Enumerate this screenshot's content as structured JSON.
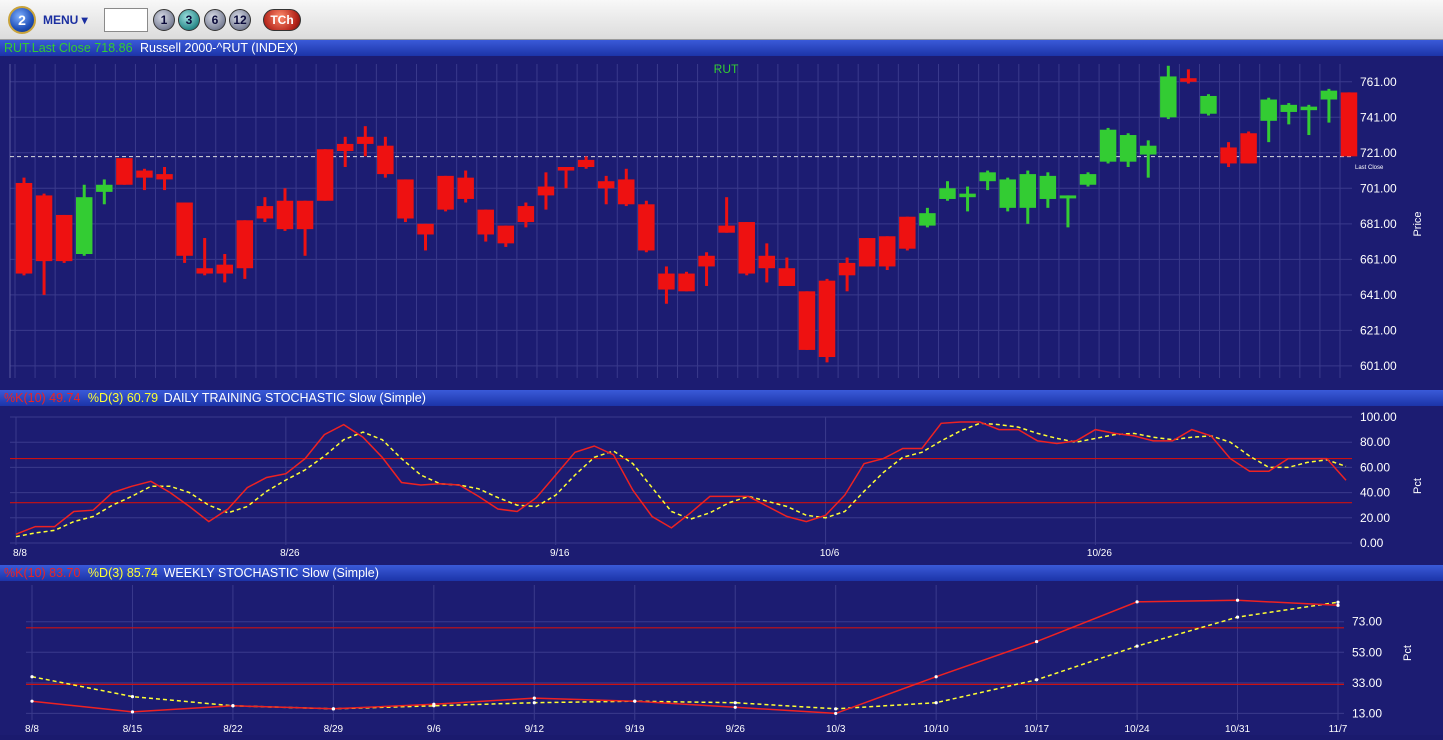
{
  "toolbar": {
    "logo_text": "2",
    "menu_label": "MENU ▾",
    "symbol_value": "",
    "period_buttons": [
      "1",
      "3",
      "6",
      "12"
    ],
    "active_period": "3",
    "tch_label": "TCh"
  },
  "header": {
    "last_close_label": "RUT.Last Close 718.86",
    "instrument": "Russell 2000-^RUT (INDEX)"
  },
  "colors": {
    "background": "#1c1c72",
    "grid": "#3a3a8c",
    "up_candle": "#33cc33",
    "down_candle": "#ee1111",
    "k_line": "#ee2222",
    "d_line": "#ffff33",
    "band_line": "#cc1111",
    "green_text": "#33cc33"
  },
  "price_chart": {
    "title": "RUT",
    "ylabel": "Price",
    "last_close_marker": "Last Close",
    "last_close": 718.86
  },
  "daily_stoch": {
    "k_label": "%K(10) 49.74",
    "d_label": "%D(3) 60.79",
    "title": "DAILY TRAINING STOCHASTIC Slow (Simple)",
    "ylabel": "Pct"
  },
  "weekly_stoch": {
    "k_label": "%K(10) 83.70",
    "d_label": "%D(3) 85.74",
    "title": "WEEKLY STOCHASTIC Slow (Simple)",
    "ylabel": "Pct"
  },
  "chart_data": [
    {
      "type": "candlestick",
      "title": "RUT",
      "ylabel": "Price",
      "ylim": [
        597,
        771
      ],
      "ytick_labels": [
        "601.00",
        "621.00",
        "641.00",
        "661.00",
        "681.00",
        "701.00",
        "721.00",
        "741.00",
        "761.00"
      ],
      "reference_line": 718.86,
      "candles": [
        {
          "o": 704,
          "c": 653,
          "h": 707,
          "l": 652
        },
        {
          "o": 697,
          "c": 660,
          "h": 698,
          "l": 641
        },
        {
          "o": 686,
          "c": 660,
          "h": 686,
          "l": 659
        },
        {
          "o": 664,
          "c": 696,
          "h": 703,
          "l": 663
        },
        {
          "o": 699,
          "c": 703,
          "h": 706,
          "l": 692
        },
        {
          "o": 718,
          "c": 703,
          "h": 718,
          "l": 703
        },
        {
          "o": 711,
          "c": 707,
          "h": 712,
          "l": 700
        },
        {
          "o": 709,
          "c": 706,
          "h": 713,
          "l": 700
        },
        {
          "o": 693,
          "c": 663,
          "h": 693,
          "l": 659
        },
        {
          "o": 656,
          "c": 653,
          "h": 673,
          "l": 652
        },
        {
          "o": 658,
          "c": 653,
          "h": 664,
          "l": 648
        },
        {
          "o": 683,
          "c": 656,
          "h": 683,
          "l": 650
        },
        {
          "o": 691,
          "c": 684,
          "h": 696,
          "l": 682
        },
        {
          "o": 694,
          "c": 678,
          "h": 701,
          "l": 677
        },
        {
          "o": 694,
          "c": 678,
          "h": 694,
          "l": 663
        },
        {
          "o": 723,
          "c": 694,
          "h": 723,
          "l": 694
        },
        {
          "o": 726,
          "c": 722,
          "h": 730,
          "l": 713
        },
        {
          "o": 730,
          "c": 726,
          "h": 736,
          "l": 719
        },
        {
          "o": 725,
          "c": 709,
          "h": 730,
          "l": 707
        },
        {
          "o": 706,
          "c": 684,
          "h": 706,
          "l": 682
        },
        {
          "o": 681,
          "c": 675,
          "h": 681,
          "l": 666
        },
        {
          "o": 708,
          "c": 689,
          "h": 708,
          "l": 688
        },
        {
          "o": 707,
          "c": 695,
          "h": 711,
          "l": 693
        },
        {
          "o": 689,
          "c": 675,
          "h": 689,
          "l": 671
        },
        {
          "o": 680,
          "c": 670,
          "h": 680,
          "l": 668
        },
        {
          "o": 691,
          "c": 682,
          "h": 693,
          "l": 679
        },
        {
          "o": 702,
          "c": 697,
          "h": 710,
          "l": 689
        },
        {
          "o": 713,
          "c": 711,
          "h": 713,
          "l": 701
        },
        {
          "o": 717,
          "c": 713,
          "h": 719,
          "l": 712
        },
        {
          "o": 705,
          "c": 701,
          "h": 708,
          "l": 692
        },
        {
          "o": 706,
          "c": 692,
          "h": 712,
          "l": 691
        },
        {
          "o": 692,
          "c": 666,
          "h": 694,
          "l": 665
        },
        {
          "o": 653,
          "c": 644,
          "h": 657,
          "l": 636
        },
        {
          "o": 653,
          "c": 643,
          "h": 654,
          "l": 643
        },
        {
          "o": 663,
          "c": 657,
          "h": 665,
          "l": 646
        },
        {
          "o": 680,
          "c": 676,
          "h": 696,
          "l": 676
        },
        {
          "o": 682,
          "c": 653,
          "h": 682,
          "l": 652
        },
        {
          "o": 663,
          "c": 656,
          "h": 670,
          "l": 648
        },
        {
          "o": 656,
          "c": 646,
          "h": 662,
          "l": 646
        },
        {
          "o": 643,
          "c": 610,
          "h": 643,
          "l": 610
        },
        {
          "o": 649,
          "c": 606,
          "h": 650,
          "l": 603
        },
        {
          "o": 659,
          "c": 652,
          "h": 662,
          "l": 643
        },
        {
          "o": 673,
          "c": 657,
          "h": 673,
          "l": 657
        },
        {
          "o": 674,
          "c": 657,
          "h": 674,
          "l": 655
        },
        {
          "o": 685,
          "c": 667,
          "h": 685,
          "l": 666
        },
        {
          "o": 680,
          "c": 687,
          "h": 690,
          "l": 679
        },
        {
          "o": 695,
          "c": 701,
          "h": 705,
          "l": 694
        },
        {
          "o": 696,
          "c": 698,
          "h": 702,
          "l": 688
        },
        {
          "o": 705,
          "c": 710,
          "h": 711,
          "l": 700
        },
        {
          "o": 690,
          "c": 706,
          "h": 707,
          "l": 688
        },
        {
          "o": 690,
          "c": 709,
          "h": 711,
          "l": 681
        },
        {
          "o": 695,
          "c": 708,
          "h": 710,
          "l": 690
        },
        {
          "o": 696,
          "c": 697,
          "h": 697,
          "l": 679
        },
        {
          "o": 703,
          "c": 709,
          "h": 710,
          "l": 702
        },
        {
          "o": 716,
          "c": 734,
          "h": 735,
          "l": 715
        },
        {
          "o": 716,
          "c": 731,
          "h": 732,
          "l": 713
        },
        {
          "o": 720,
          "c": 725,
          "h": 728,
          "l": 707
        },
        {
          "o": 741,
          "c": 764,
          "h": 770,
          "l": 740
        },
        {
          "o": 763,
          "c": 761,
          "h": 768,
          "l": 760
        },
        {
          "o": 743,
          "c": 753,
          "h": 754,
          "l": 742
        },
        {
          "o": 724,
          "c": 715,
          "h": 727,
          "l": 713
        },
        {
          "o": 732,
          "c": 715,
          "h": 733,
          "l": 715
        },
        {
          "o": 739,
          "c": 751,
          "h": 752,
          "l": 727
        },
        {
          "o": 744,
          "c": 748,
          "h": 749,
          "l": 737
        },
        {
          "o": 745,
          "c": 747,
          "h": 748,
          "l": 731
        },
        {
          "o": 751,
          "c": 756,
          "h": 757,
          "l": 738
        },
        {
          "o": 755,
          "c": 719,
          "h": 755,
          "l": 719
        }
      ]
    },
    {
      "type": "line",
      "title": "DAILY TRAINING STOCHASTIC Slow (Simple)",
      "ylabel": "Pct",
      "ylim": [
        0,
        100
      ],
      "ytick_labels": [
        "0.00",
        "20.00",
        "40.00",
        "60.00",
        "80.00",
        "100.00"
      ],
      "reference_lines": [
        32,
        67
      ],
      "x_labels": [
        "8/8",
        "8/26",
        "9/16",
        "10/6",
        "10/26"
      ],
      "series": [
        {
          "name": "%K(10)",
          "values": [
            7,
            13,
            13,
            25,
            26,
            40,
            45,
            49,
            40,
            29,
            17,
            27,
            44,
            52,
            55,
            67,
            86,
            94,
            84,
            68,
            48,
            46,
            47,
            46,
            37,
            27,
            25,
            36,
            54,
            72,
            77,
            70,
            42,
            21,
            12,
            24,
            37,
            37,
            37,
            29,
            21,
            17,
            22,
            38,
            63,
            67,
            75,
            75,
            95,
            96,
            96,
            90,
            90,
            81,
            79,
            81,
            90,
            87,
            85,
            81,
            81,
            90,
            85,
            67,
            57,
            57,
            67,
            67,
            67,
            49.74
          ]
        },
        {
          "name": "%D(3)",
          "values": [
            5,
            8,
            10,
            17,
            21,
            30,
            37,
            45,
            45,
            40,
            30,
            24,
            29,
            41,
            50,
            58,
            69,
            82,
            88,
            82,
            67,
            54,
            47,
            46,
            43,
            36,
            30,
            29,
            38,
            54,
            68,
            73,
            63,
            44,
            25,
            19,
            24,
            32,
            37,
            33,
            29,
            22,
            20,
            25,
            41,
            56,
            68,
            72,
            81,
            89,
            95,
            94,
            92,
            87,
            83,
            80,
            83,
            86,
            87,
            84,
            82,
            84,
            85,
            80,
            69,
            60,
            60,
            64,
            66,
            60.79
          ]
        }
      ]
    },
    {
      "type": "line",
      "title": "WEEKLY STOCHASTIC Slow (Simple)",
      "ylabel": "Pct",
      "ylim": [
        10,
        97
      ],
      "ytick_labels": [
        "13.00",
        "33.00",
        "53.00",
        "73.00"
      ],
      "reference_lines": [
        32,
        69
      ],
      "x_labels": [
        "8/8",
        "8/15",
        "8/22",
        "8/29",
        "9/6",
        "9/12",
        "9/19",
        "9/26",
        "10/3",
        "10/10",
        "10/17",
        "10/24",
        "10/31",
        "11/7"
      ],
      "series": [
        {
          "name": "%K(10)",
          "values": [
            21,
            14,
            18,
            16,
            19,
            23,
            21,
            17,
            13,
            37,
            60,
            86,
            87,
            83.7
          ]
        },
        {
          "name": "%D(3)",
          "values": [
            37,
            24,
            18,
            16,
            18,
            20,
            21,
            20,
            16,
            20,
            35,
            57,
            76,
            85.74
          ]
        }
      ]
    }
  ]
}
